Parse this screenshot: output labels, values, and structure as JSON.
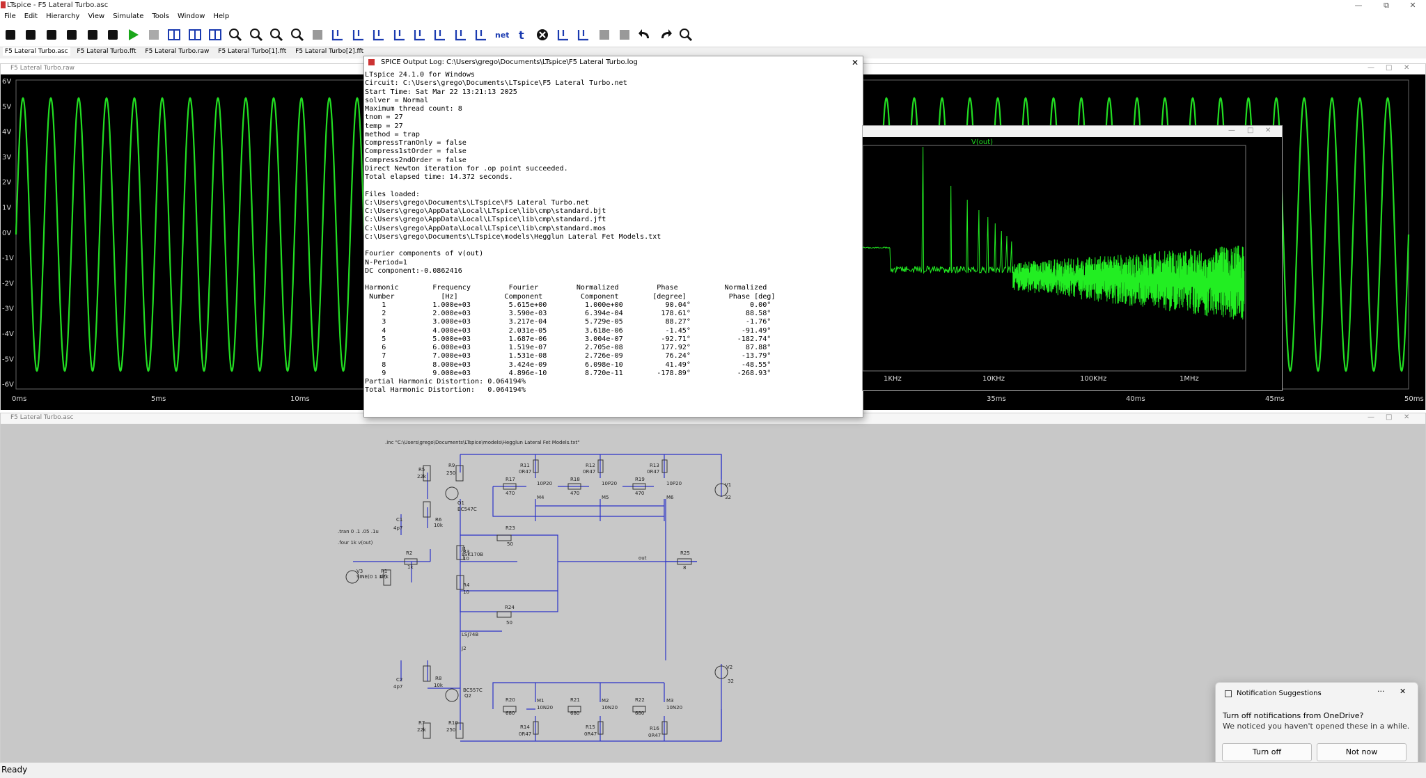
{
  "app": {
    "title": "LTspice - F5 Lateral Turbo.asc"
  },
  "menu": [
    "File",
    "Edit",
    "Hierarchy",
    "View",
    "Simulate",
    "Tools",
    "Window",
    "Help"
  ],
  "doc_tabs": [
    "F5 Lateral Turbo.asc",
    "F5 Lateral Turbo.fft",
    "F5 Lateral Turbo.raw",
    "F5 Lateral Turbo[1].fft",
    "F5 Lateral Turbo[2].fft"
  ],
  "toolbar": {
    "icons": [
      "gear-icon",
      "open-icon",
      "open-folder-icon",
      "save-icon",
      "print-icon",
      "control-panel-icon",
      "run-icon",
      "halt-icon",
      "tile-vertical-icon",
      "tile-horizontal-icon",
      "cascade-icon",
      "zoom-in-icon",
      "zoom-out-icon",
      "zoom-fit-icon",
      "zoom-full-icon",
      "autorange-icon",
      "wire-icon",
      "ground-icon",
      "label-icon",
      "resistor-icon",
      "capacitor-icon",
      "inductor-icon",
      "diode-icon",
      "component-icon",
      "spice-directive-icon",
      "text-icon",
      "delete-icon",
      "move-icon",
      "drag-icon",
      "rotate-icon",
      "mirror-icon",
      "undo-icon",
      "redo-icon",
      "find-icon"
    ],
    "net_label": "net",
    "t_label": "t"
  },
  "waveform": {
    "caption": "F5 Lateral Turbo.raw",
    "y_ticks": [
      "6V",
      "5V",
      "4V",
      "3V",
      "2V",
      "1V",
      "0V",
      "-1V",
      "-2V",
      "-3V",
      "-4V",
      "-5V",
      "-6V"
    ],
    "x_ticks": [
      "0ms",
      "5ms",
      "10ms",
      "35ms",
      "40ms",
      "45ms",
      "50ms"
    ],
    "trace_color": "#22dd22"
  },
  "fft": {
    "trace_label": "V(out)",
    "x_ticks": [
      "1KHz",
      "10KHz",
      "100KHz",
      "1MHz"
    ]
  },
  "log": {
    "title": "SPICE Output Log: C:\\Users\\grego\\Documents\\LTspice\\F5 Lateral Turbo.log",
    "lines": [
      "LTspice 24.1.0 for Windows",
      "Circuit: C:\\Users\\grego\\Documents\\LTspice\\F5 Lateral Turbo.net",
      "Start Time: Sat Mar 22 13:21:13 2025",
      "solver = Normal",
      "Maximum thread count: 8",
      "tnom = 27",
      "temp = 27",
      "method = trap",
      "CompressTranOnly = false",
      "Compress1stOrder = false",
      "Compress2ndOrder = false",
      "Direct Newton iteration for .op point succeeded.",
      "Total elapsed time: 14.372 seconds.",
      "",
      "Files loaded:",
      "C:\\Users\\grego\\Documents\\LTspice\\F5 Lateral Turbo.net",
      "C:\\Users\\grego\\AppData\\Local\\LTspice\\lib\\cmp\\standard.bjt",
      "C:\\Users\\grego\\AppData\\Local\\LTspice\\lib\\cmp\\standard.jft",
      "C:\\Users\\grego\\AppData\\Local\\LTspice\\lib\\cmp\\standard.mos",
      "C:\\Users\\grego\\Documents\\LTspice\\models\\Hegglun Lateral Fet Models.txt",
      "",
      "Fourier components of v(out)",
      "N-Period=1",
      "DC component:-0.0862416",
      "",
      "Harmonic        Frequency         Fourier         Normalized         Phase           Normalized",
      " Number           [Hz]           Component         Component        [degree]          Phase [deg]",
      "    1           1.000e+03         5.615e+00         1.000e+00          90.04°              0.00°",
      "    2           2.000e+03         3.590e-03         6.394e-04         178.61°             88.58°",
      "    3           3.000e+03         3.217e-04         5.729e-05          88.27°             -1.76°",
      "    4           4.000e+03         2.031e-05         3.618e-06          -1.45°            -91.49°",
      "    5           5.000e+03         1.687e-06         3.004e-07         -92.71°           -182.74°",
      "    6           6.000e+03         1.519e-07         2.705e-08         177.92°             87.88°",
      "    7           7.000e+03         1.531e-08         2.726e-09          76.24°            -13.79°",
      "    8           8.000e+03         3.424e-09         6.098e-10          41.49°            -48.55°",
      "    9           9.000e+03         4.896e-10         8.720e-11        -178.89°           -268.93°",
      "Partial Harmonic Distortion: 0.064194%",
      "Total Harmonic Distortion:   0.064194%"
    ]
  },
  "schematic": {
    "caption": "F5 Lateral Turbo.asc",
    "include": ".inc \"C:\\Users\\grego\\Documents\\LTspice\\models\\Hegglun Lateral Fet Models.txt\"",
    "tran": ".tran 0 .1 .05 .1u",
    "four": ".four 1k v(out)",
    "labels": [
      {
        "id": "R5",
        "t": "R5"
      },
      {
        "id": "R5v",
        "t": "22k"
      },
      {
        "id": "R9",
        "t": "R9"
      },
      {
        "id": "R9v",
        "t": "250"
      },
      {
        "id": "Q1",
        "t": "Q1"
      },
      {
        "id": "Q1v",
        "t": "BC547C"
      },
      {
        "id": "C1",
        "t": "C1"
      },
      {
        "id": "C1v",
        "t": "4p7"
      },
      {
        "id": "R6",
        "t": "R6"
      },
      {
        "id": "R6v",
        "t": "10k"
      },
      {
        "id": "J1",
        "t": "J1"
      },
      {
        "id": "J1v",
        "t": "LSK170B"
      },
      {
        "id": "R11",
        "t": "R11"
      },
      {
        "id": "R11v",
        "t": "0R47"
      },
      {
        "id": "R12",
        "t": "R12"
      },
      {
        "id": "R12v",
        "t": "0R47"
      },
      {
        "id": "R13",
        "t": "R13"
      },
      {
        "id": "R13v",
        "t": "0R47"
      },
      {
        "id": "R17",
        "t": "R17"
      },
      {
        "id": "R17v",
        "t": "470"
      },
      {
        "id": "R18",
        "t": "R18"
      },
      {
        "id": "R18v",
        "t": "470"
      },
      {
        "id": "R19",
        "t": "R19"
      },
      {
        "id": "R19v",
        "t": "470"
      },
      {
        "id": "M4",
        "t": "M4"
      },
      {
        "id": "M4v",
        "t": "10P20"
      },
      {
        "id": "M5",
        "t": "M5"
      },
      {
        "id": "M5v",
        "t": "10P20"
      },
      {
        "id": "M6",
        "t": "M6"
      },
      {
        "id": "M6v",
        "t": "10P20"
      },
      {
        "id": "V1",
        "t": "V1"
      },
      {
        "id": "V1v",
        "t": "32"
      },
      {
        "id": "R23",
        "t": "R23"
      },
      {
        "id": "R23v",
        "t": "50"
      },
      {
        "id": "R3",
        "t": "R3"
      },
      {
        "id": "R3v",
        "t": "10"
      },
      {
        "id": "R4",
        "t": "R4"
      },
      {
        "id": "R4v",
        "t": "10"
      },
      {
        "id": "R2",
        "t": "R2"
      },
      {
        "id": "R2v",
        "t": "1k"
      },
      {
        "id": "V3",
        "t": "V3"
      },
      {
        "id": "V3v",
        "t": "SINE(0 1 1k)"
      },
      {
        "id": "R1",
        "t": "R1"
      },
      {
        "id": "R1v",
        "t": "47k"
      },
      {
        "id": "out",
        "t": "out"
      },
      {
        "id": "R25",
        "t": "R25"
      },
      {
        "id": "R25v",
        "t": "8"
      },
      {
        "id": "R24",
        "t": "R24"
      },
      {
        "id": "R24v",
        "t": "50"
      },
      {
        "id": "J2",
        "t": "J2"
      },
      {
        "id": "J2v",
        "t": "LSJ74B"
      },
      {
        "id": "C2",
        "t": "C2"
      },
      {
        "id": "C2v",
        "t": "4p7"
      },
      {
        "id": "R8",
        "t": "R8"
      },
      {
        "id": "R8v",
        "t": "10k"
      },
      {
        "id": "Q2",
        "t": "Q2"
      },
      {
        "id": "Q2v",
        "t": "BC557C"
      },
      {
        "id": "R20",
        "t": "R20"
      },
      {
        "id": "R20v",
        "t": "680"
      },
      {
        "id": "R21",
        "t": "R21"
      },
      {
        "id": "R21v",
        "t": "680"
      },
      {
        "id": "R22",
        "t": "R22"
      },
      {
        "id": "R22v",
        "t": "680"
      },
      {
        "id": "M1",
        "t": "M1"
      },
      {
        "id": "M1v",
        "t": "10N20"
      },
      {
        "id": "M2",
        "t": "M2"
      },
      {
        "id": "M2v",
        "t": "10N20"
      },
      {
        "id": "M3",
        "t": "M3"
      },
      {
        "id": "M3v",
        "t": "10N20"
      },
      {
        "id": "V2",
        "t": "V2"
      },
      {
        "id": "V2v",
        "t": "32"
      },
      {
        "id": "R7",
        "t": "R7"
      },
      {
        "id": "R7v",
        "t": "22k"
      },
      {
        "id": "R10",
        "t": "R10"
      },
      {
        "id": "R10v",
        "t": "250"
      },
      {
        "id": "R14",
        "t": "R14"
      },
      {
        "id": "R14v",
        "t": "0R47"
      },
      {
        "id": "R15",
        "t": "R15"
      },
      {
        "id": "R15v",
        "t": "0R47"
      },
      {
        "id": "R16",
        "t": "R16"
      },
      {
        "id": "R16v",
        "t": "0R47"
      }
    ]
  },
  "notification": {
    "header": "Notification Suggestions",
    "title": "Turn off notifications from OneDrive?",
    "body": "We noticed you haven't opened these in a while.",
    "primary": "Turn off",
    "secondary": "Not now"
  },
  "status": {
    "text": "Ready"
  }
}
